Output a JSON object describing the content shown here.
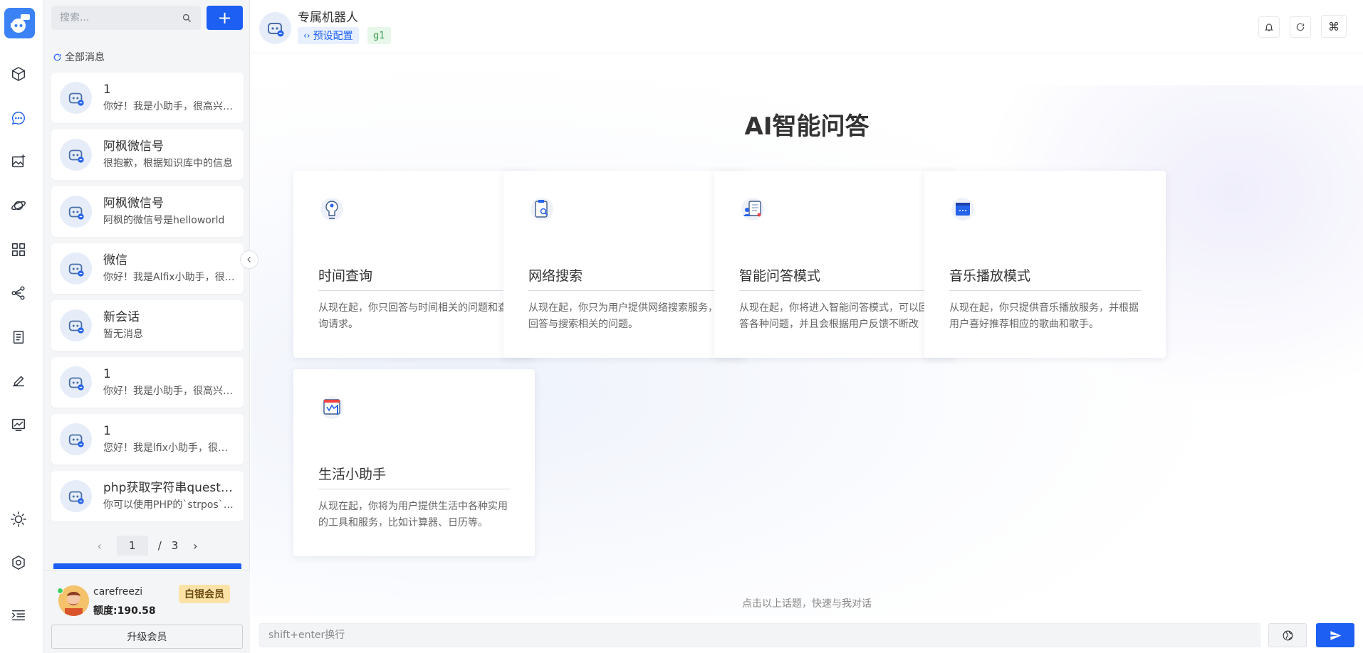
{
  "search": {
    "placeholder": "搜索..."
  },
  "sidebar": {
    "all_messages_label": "全部消息",
    "conversations": [
      {
        "title": "1",
        "preview": "你好！我是小助手，很高兴为你服务"
      },
      {
        "title": "阿枫微信号",
        "preview": "很抱歉，根据知识库中的信息"
      },
      {
        "title": "阿枫微信号",
        "preview": "阿枫的微信号是helloworld"
      },
      {
        "title": "微信",
        "preview": "你好！我是Alfix小助手，很高兴"
      },
      {
        "title": "新会话",
        "preview": "暂无消息"
      },
      {
        "title": "1",
        "preview": "你好！我是小助手，很高兴为你服务"
      },
      {
        "title": "1",
        "preview": "您好！我是lfix小助手，很高兴"
      },
      {
        "title": "php获取字符串question",
        "preview": "你可以使用PHP的`strpos`函数"
      }
    ],
    "pager": {
      "current": "1",
      "separator": "/",
      "total": "3"
    },
    "user": {
      "name": "carefreezi",
      "quota": "额度:190.58",
      "member": "白银会员",
      "upgrade_label": "升级会员"
    }
  },
  "header": {
    "bot_name": "专属机器人",
    "preset_label": "预设配置",
    "group_tag": "g1",
    "cmd_label": "⌘"
  },
  "main": {
    "title": "AI智能问答",
    "cards": [
      {
        "title": "时间查询",
        "desc": "从现在起，你只回答与时间相关的问题和查询请求。"
      },
      {
        "title": "网络搜索",
        "desc": "从现在起，你只为用户提供网络搜索服务，回答与搜索相关的问题。"
      },
      {
        "title": "智能问答模式",
        "desc": "从现在起，你将进入智能问答模式，可以回答各种问题，并且会根据用户反馈不断改进。"
      },
      {
        "title": "音乐播放模式",
        "desc": "从现在起，你只提供音乐播放服务，并根据用户喜好推荐相应的歌曲和歌手。"
      },
      {
        "title": "生活小助手",
        "desc": "从现在起，你将为用户提供生活中各种实用的工具和服务，比如计算器、日历等。"
      }
    ],
    "hint": "点击以上话题，快速与我对话",
    "input_placeholder": "shift+enter换行"
  },
  "colors": {
    "accent": "#1d5ff2",
    "panel_bg": "#f4f5f7",
    "member_badge": "#fbe2a6"
  },
  "icons": {
    "rail": [
      "logo-robot-icon",
      "cube-icon",
      "chat-icon",
      "image-icon",
      "planet-icon",
      "apps-icon",
      "share-nodes-icon",
      "document-icon",
      "pen-icon",
      "chart-icon",
      "sun-icon",
      "settings-icon",
      "menu-indent-icon"
    ]
  }
}
